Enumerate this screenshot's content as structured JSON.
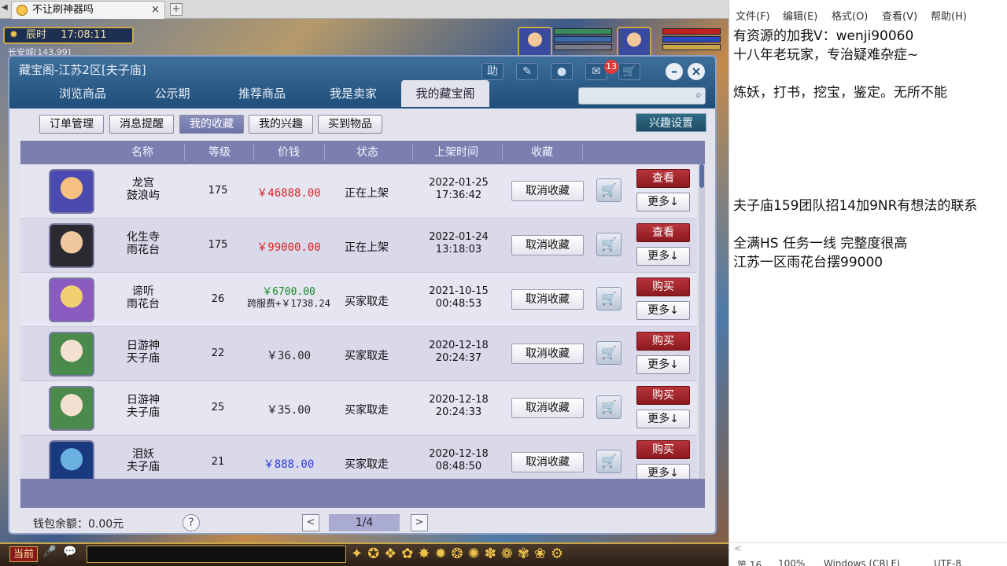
{
  "browser": {
    "tab_title": "不让刷神器吗",
    "close": "×",
    "new_tab": "+"
  },
  "hud": {
    "period": "辰时",
    "time": "17:08:11",
    "city": "长安城[143,99]"
  },
  "panel": {
    "title": "藏宝阁-江苏2区[夫子庙]",
    "icons": {
      "help": "助",
      "chat_badge": "13"
    },
    "main_tabs": [
      "浏览商品",
      "公示期",
      "推荐商品",
      "我是卖家",
      "我的藏宝阁"
    ],
    "active_main_tab": "我的藏宝阁",
    "search_placeholder": "",
    "sub_tabs": [
      "订单管理",
      "消息提醒",
      "我的收藏",
      "我的兴趣",
      "买到物品"
    ],
    "active_sub_tab": "我的收藏",
    "interest_button": "兴趣设置",
    "columns": [
      "名称",
      "等级",
      "价钱",
      "状态",
      "上架时间",
      "收藏"
    ],
    "rows": [
      {
        "name1": "龙宫",
        "name2": "鼓浪屿",
        "level": "175",
        "price": "￥46888.00",
        "price_color": "#e02020",
        "price2": "",
        "status": "正在上架",
        "date": "2022-01-25",
        "clock": "17:36:42",
        "unfav": "取消收藏",
        "action": "查看",
        "more": "更多↓",
        "avatar": [
          "#f5c080",
          "#4a4ab0"
        ]
      },
      {
        "name1": "化生寺",
        "name2": "雨花台",
        "level": "175",
        "price": "￥99000.00",
        "price_color": "#e02020",
        "price2": "",
        "status": "正在上架",
        "date": "2022-01-24",
        "clock": "13:18:03",
        "unfav": "取消收藏",
        "action": "查看",
        "more": "更多↓",
        "avatar": [
          "#f0c8a0",
          "#2a2a30"
        ]
      },
      {
        "name1": "谛听",
        "name2": "雨花台",
        "level": "26",
        "price": "￥6700.00",
        "price_color": "#1a8a2a",
        "price2": "跨服费+￥1738.24",
        "status": "买家取走",
        "date": "2021-10-15",
        "clock": "00:48:53",
        "unfav": "取消收藏",
        "action": "购买",
        "more": "更多↓",
        "avatar": [
          "#f0d070",
          "#8a5ac0"
        ]
      },
      {
        "name1": "日游神",
        "name2": "天子庙",
        "level": "22",
        "price": "￥36.00",
        "price_color": "#222222",
        "price2": "",
        "status": "买家取走",
        "date": "2020-12-18",
        "clock": "20:24:37",
        "unfav": "取消收藏",
        "action": "购买",
        "more": "更多↓",
        "avatar": [
          "#f4e0d0",
          "#4a8a4a"
        ]
      },
      {
        "name1": "日游神",
        "name2": "夫子庙",
        "level": "25",
        "price": "￥35.00",
        "price_color": "#222222",
        "price2": "",
        "status": "买家取走",
        "date": "2020-12-18",
        "clock": "20:24:33",
        "unfav": "取消收藏",
        "action": "购买",
        "more": "更多↓",
        "avatar": [
          "#f4e0d0",
          "#4a8a4a"
        ]
      },
      {
        "name1": "泪妖",
        "name2": "夫子庙",
        "level": "21",
        "price": "￥888.00",
        "price_color": "#2a3ae0",
        "price2": "",
        "status": "买家取走",
        "date": "2020-12-18",
        "clock": "08:48:50",
        "unfav": "取消收藏",
        "action": "购买",
        "more": "更多↓",
        "avatar": [
          "#6ab0e0",
          "#1a3a80"
        ]
      }
    ],
    "wallet": "钱包余额：0.00元",
    "help": "?",
    "page": "1/4",
    "prev": "<",
    "next": ">"
  },
  "bottom": {
    "current_channel": "当前"
  },
  "notepad": {
    "menu": [
      "文件(F)",
      "编辑(E)",
      "格式(O)",
      "查看(V)",
      "帮助(H)"
    ],
    "text": "有资源的加我V：wenji90060\n十八年老玩家，专治疑难杂症~\n\n炼妖，打书，挖宝，鉴定。无所不能\n\n\n\n\n\n夫子庙159团队招14加9NR有想法的联系\n\n全满HS 任务一线 完整度很高\n江苏一区雨花台摆99000",
    "status": [
      "第 16，",
      "100%",
      "Windows (CRLF)",
      "UTF-8"
    ]
  }
}
